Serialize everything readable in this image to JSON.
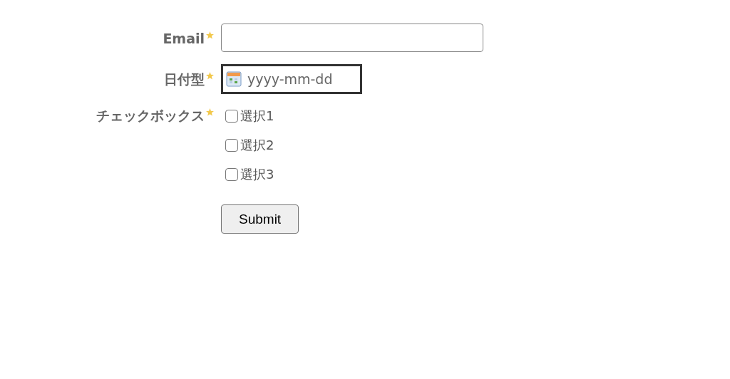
{
  "fields": [
    {
      "kind": "text",
      "label": "Email",
      "required": true,
      "focused": false
    },
    {
      "kind": "date",
      "label": "日付型",
      "required": true,
      "focused": true,
      "placeholder": "yyyy-mm-dd"
    },
    {
      "kind": "checkboxes",
      "label": "チェックボックス",
      "required": true,
      "options": [
        {
          "label": "選択1",
          "checked": false
        },
        {
          "label": "選択2",
          "checked": false
        },
        {
          "label": "選択3",
          "checked": false
        }
      ]
    }
  ],
  "submit": {
    "label": "Submit"
  }
}
